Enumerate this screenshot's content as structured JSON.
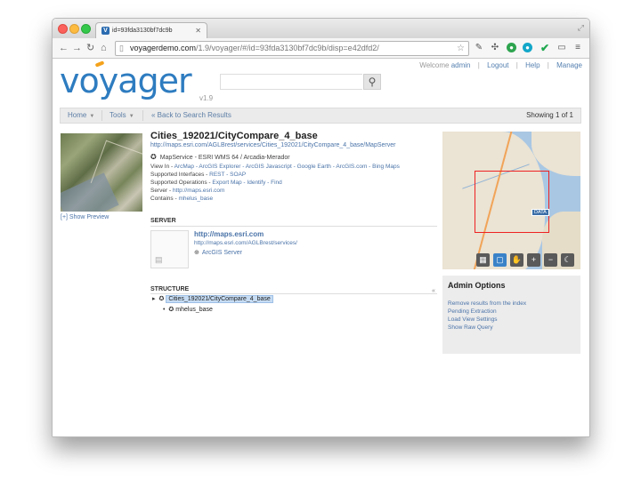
{
  "browser": {
    "tab_title": "id=93fda3130bf7dc9b",
    "tab_favicon": "V",
    "url_host": "voyagerdemo.com",
    "url_path": "/1.9/voyager/#/id=93fda3130bf7dc9b/disp=e42dfd2/",
    "icons": [
      "close-light-icon",
      "minimize-light-icon",
      "zoom-light-icon",
      "back-icon",
      "forward-icon",
      "reload-icon",
      "home-icon",
      "bookmark-star-icon",
      "wrench-icon",
      "extension-green-icon",
      "extension-teal-icon",
      "check-icon",
      "cast-icon",
      "menu-icon"
    ]
  },
  "header": {
    "logo_text": "voyager",
    "version": "v1.9",
    "search_placeholder": "",
    "links": {
      "welcome": "Welcome",
      "user": "admin",
      "logout": "Logout",
      "help": "Help",
      "manage": "Manage"
    }
  },
  "navbar": {
    "home": "Home",
    "tools": "Tools",
    "back": "« Back to Search Results",
    "showing": "Showing 1 of 1"
  },
  "record": {
    "title": "Cities_192021/CityCompare_4_base",
    "rest_url": "http://maps.esri.com/AGLBrest/services/Cities_192021/CityCompare_4_base/MapServer",
    "service_line": "MapService - ESRI WMS 64 / Arcadia-Merador",
    "view_in_label": "View In",
    "view_in_value": "ArcMap - ArcGIS Explorer - ArcGIS Javascript - Google Earth - ArcGIS.com - Bing Maps",
    "interfaces_label": "Supported Interfaces",
    "interfaces_value": "REST - SOAP",
    "operations_label": "Supported Operations",
    "operations_value": "Export Map - Identify - Find",
    "server_label": "Server",
    "server_value": "http://maps.esri.com",
    "contains_label": "Contains",
    "contains_value": "mhelus_base",
    "show_preview": "[+] Show Preview"
  },
  "server_section": {
    "label": "SERVER",
    "link": "http://maps.esri.com",
    "url": "http://maps.esri.com/AGLBrest/services/",
    "type": "ArcGIS Server"
  },
  "structure": {
    "label": "STRUCTURE",
    "collapse": "«",
    "root": "Cities_192021/CityCompare_4_base",
    "child": "mhelus_base"
  },
  "map": {
    "label": "DATA",
    "tools": [
      "grid-icon",
      "select-box-icon",
      "pan-hand-icon",
      "zoom-in-icon",
      "zoom-out-icon",
      "moon-icon"
    ]
  },
  "admin": {
    "title": "Admin Options",
    "links": [
      "Remove results from the index",
      "Pending Extraction",
      "Load View Settings",
      "Show Raw Query"
    ]
  }
}
